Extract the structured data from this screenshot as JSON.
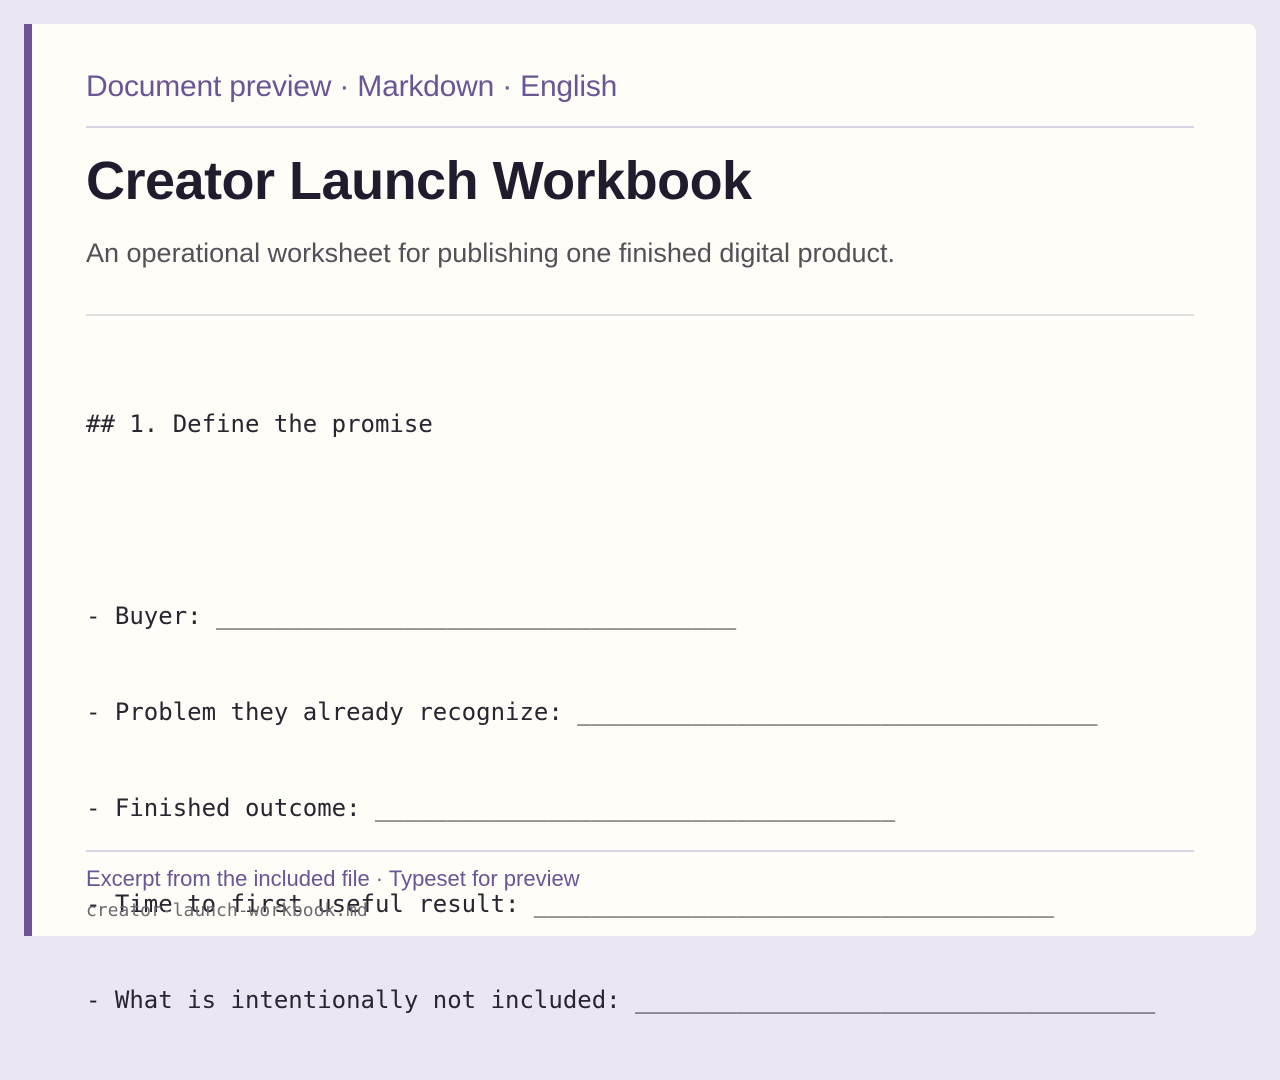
{
  "header": {
    "meta": "Document preview · Markdown · English"
  },
  "document": {
    "title": "Creator Launch Workbook",
    "subtitle": "An operational worksheet for publishing one finished digital product.",
    "lines": [
      "## 1. Define the promise",
      "",
      "- Buyer: ____________________________________",
      "- Problem they already recognize: ____________________________________",
      "- Finished outcome: ____________________________________",
      "- Time to first useful result: ____________________________________",
      "- What is intentionally not included: ____________________________________"
    ]
  },
  "footer": {
    "label": "Excerpt from the included file · Typeset for preview",
    "filename": "creator-launch-workbook.md"
  },
  "colors": {
    "accent": "#6b5594",
    "background": "#ebe7f2",
    "paper": "#fefdf7"
  }
}
